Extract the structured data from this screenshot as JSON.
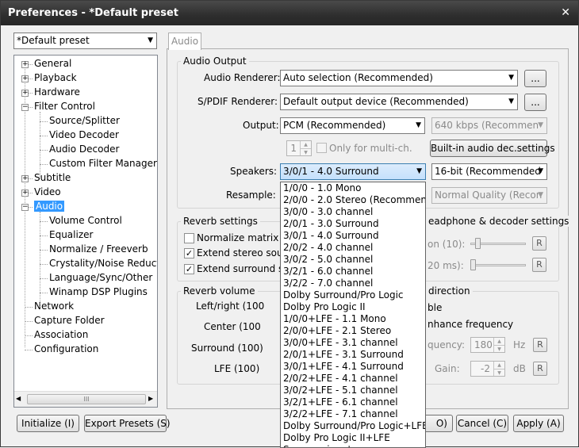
{
  "window": {
    "title": "Preferences - *Default preset",
    "close": "✕"
  },
  "preset_combo": "*Default preset",
  "tree": {
    "items": [
      {
        "label": "General",
        "level": 0,
        "expander": "+"
      },
      {
        "label": "Playback",
        "level": 0,
        "expander": "+"
      },
      {
        "label": "Hardware",
        "level": 0,
        "expander": "+"
      },
      {
        "label": "Filter Control",
        "level": 0,
        "expander": "−"
      },
      {
        "label": "Source/Splitter",
        "level": 1
      },
      {
        "label": "Video Decoder",
        "level": 1
      },
      {
        "label": "Audio Decoder",
        "level": 1
      },
      {
        "label": "Custom Filter Manager",
        "level": 1
      },
      {
        "label": "Subtitle",
        "level": 0,
        "expander": "+"
      },
      {
        "label": "Video",
        "level": 0,
        "expander": "+"
      },
      {
        "label": "Audio",
        "level": 0,
        "expander": "−",
        "selected": true
      },
      {
        "label": "Volume Control",
        "level": 1
      },
      {
        "label": "Equalizer",
        "level": 1
      },
      {
        "label": "Normalize / Freeverb",
        "level": 1
      },
      {
        "label": "Crystality/Noise Reductic",
        "level": 1
      },
      {
        "label": "Language/Sync/Other",
        "level": 1
      },
      {
        "label": "Winamp DSP Plugins",
        "level": 1
      },
      {
        "label": "Network",
        "level": 0
      },
      {
        "label": "Capture Folder",
        "level": 0
      },
      {
        "label": "Association",
        "level": 0
      },
      {
        "label": "Configuration",
        "level": 0
      }
    ],
    "scroll_grip": "III"
  },
  "tab": "Audio",
  "audio_output": {
    "title": "Audio Output",
    "renderer_label": "Audio Renderer:",
    "renderer_value": "Auto selection (Recommended)",
    "spdif_label": "S/PDIF Renderer:",
    "spdif_value": "Default output device (Recommended)",
    "more": "...",
    "output_label": "Output:",
    "output_value": "PCM (Recommended)",
    "bitrate_value": "640 kbps (Recommen",
    "channels_value": "1",
    "multich_label": "Only for multi-ch.",
    "builtin_button": "Built-in audio dec.settings",
    "speakers_label": "Speakers:",
    "speakers_value": "3/0/1 - 4.0 Surround",
    "bits_value": "16-bit (Recommended",
    "resample_label": "Resample:",
    "quality_value": "Normal Quality (Recon"
  },
  "speakers_options": [
    "1/0/0 - 1.0 Mono",
    "2/0/0 - 2.0 Stereo (Recommende",
    "3/0/0 - 3.0 channel",
    "2/0/1 - 3.0 Surround",
    "3/0/1 - 4.0 Surround",
    "2/0/2 - 4.0 channel",
    "3/0/2 - 5.0 channel",
    "3/2/1 - 6.0 channel",
    "3/2/2 - 7.0 channel",
    "Dolby Surround/Pro Logic",
    "Dolby Pro Logic II",
    "1/0/0+LFE - 1.1 Mono",
    "2/0/0+LFE - 2.1 Stereo",
    "3/0/0+LFE - 3.1 channel",
    "2/0/1+LFE - 3.1 Surround",
    "3/0/1+LFE - 4.1 Surround",
    "2/0/2+LFE - 4.1 channel",
    "3/0/2+LFE - 5.1 channel",
    "3/2/1+LFE - 6.1 channel",
    "3/2/2+LFE - 7.1 channel",
    "Dolby Surround/Pro Logic+LFE",
    "Dolby Pro Logic II+LFE",
    "Same as input"
  ],
  "speakers_selected_index": 4,
  "reverb": {
    "title": "Reverb settings",
    "normalize": "Normalize matrix",
    "extend_stereo": "Extend stereo soun",
    "extend_surround": "Extend surround sc"
  },
  "headphone": {
    "title": "eadphone & decoder settings",
    "row1": "on (10):",
    "row2": "20 ms):",
    "reset": "R"
  },
  "reverb_volume": {
    "title": "Reverb volume",
    "left_right": "Left/right (100",
    "center": "Center (100",
    "surround": "Surround (100)",
    "lfe": "LFE (100)"
  },
  "direction": {
    "title": "direction",
    "enable": "ble",
    "enhance": "nhance frequency",
    "frequency_label": "quency:",
    "frequency_value": "180",
    "frequency_unit": "Hz",
    "gain_label": "Gain:",
    "gain_value": "-2",
    "gain_unit": "dB",
    "reset": "R"
  },
  "buttons": {
    "initialize": "Initialize (I)",
    "export": "Export Presets (S)",
    "ok": "O)",
    "cancel": "Cancel (C)",
    "apply": "Apply (A)"
  }
}
